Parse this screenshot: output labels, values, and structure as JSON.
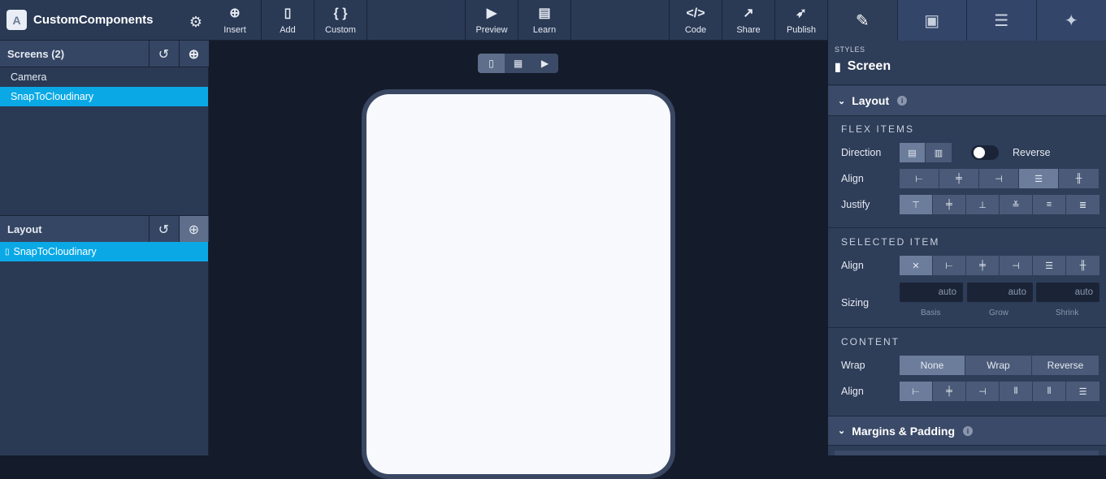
{
  "app": {
    "title": "CustomComponents",
    "logo": "A"
  },
  "screens_panel": {
    "title": "Screens (2)",
    "items": [
      "Camera",
      "SnapToCloudinary"
    ],
    "selected": "SnapToCloudinary"
  },
  "layout_panel": {
    "title": "Layout",
    "items": [
      "SnapToCloudinary"
    ]
  },
  "toolbar": {
    "insert": "Insert",
    "add": "Add",
    "custom": "Custom",
    "preview": "Preview",
    "learn": "Learn",
    "code": "Code",
    "share": "Share",
    "publish": "Publish"
  },
  "right_panel": {
    "styles_label": "STYLES",
    "target": "Screen",
    "layout": {
      "title": "Layout",
      "flex_items": "FLEX ITEMS",
      "direction": "Direction",
      "reverse": "Reverse",
      "align": "Align",
      "justify": "Justify",
      "selected_item": "SELECTED ITEM",
      "sizing": "Sizing",
      "basis_value": "auto",
      "grow_value": "auto",
      "shrink_value": "auto",
      "basis": "Basis",
      "grow": "Grow",
      "shrink": "Shrink",
      "content": "CONTENT",
      "wrap": "Wrap",
      "wrap_options": [
        "None",
        "Wrap",
        "Reverse"
      ]
    },
    "margins": {
      "title": "Margins & Padding"
    }
  },
  "colors": {
    "accent": "#0aa9e6",
    "sidebar": "#2a3a55",
    "canvas": "#141b2b"
  },
  "icons": [
    "gear-icon",
    "history-icon",
    "plus-circle-icon",
    "plus-icon",
    "phone-icon",
    "braces-icon",
    "play-icon",
    "book-icon",
    "code-icon",
    "share-icon",
    "rocket-icon",
    "brush-icon",
    "layout-icon",
    "database-icon",
    "magic-wand-icon",
    "info-icon"
  ]
}
